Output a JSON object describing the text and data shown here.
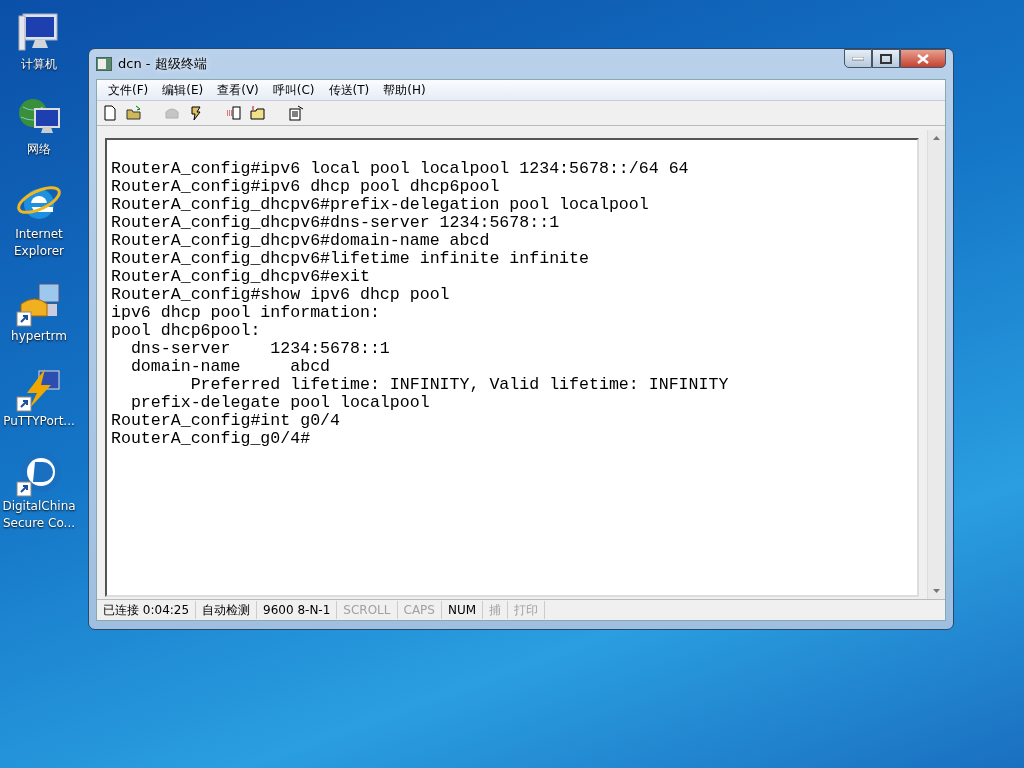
{
  "desktop_icons": [
    {
      "kind": "computer",
      "label": "计算机"
    },
    {
      "kind": "network",
      "label": "网络"
    },
    {
      "kind": "browser",
      "label": "Internet Explorer"
    },
    {
      "kind": "phone",
      "label": "hypertrm",
      "shortcut": true
    },
    {
      "kind": "bolt",
      "label": "PuTTYPort...",
      "shortcut": true
    },
    {
      "kind": "disc",
      "label": "DigitalChina Secure Co...",
      "shortcut": true
    }
  ],
  "window": {
    "title": "dcn - 超级终端",
    "menu": [
      "文件(F)",
      "编辑(E)",
      "查看(V)",
      "呼叫(C)",
      "传送(T)",
      "帮助(H)"
    ],
    "toolbar": [
      {
        "kind": "new",
        "disabled": false
      },
      {
        "kind": "open",
        "disabled": false
      },
      {
        "kind": "phone",
        "disabled": true
      },
      {
        "kind": "hangup",
        "disabled": false
      },
      {
        "kind": "send",
        "disabled": false
      },
      {
        "kind": "receive",
        "disabled": false
      },
      {
        "kind": "properties",
        "disabled": false
      }
    ],
    "terminal_lines": [
      "RouterA_config#ipv6 local pool localpool 1234:5678::/64 64",
      "RouterA_config#ipv6 dhcp pool dhcp6pool",
      "RouterA_config_dhcpv6#prefix-delegation pool localpool",
      "RouterA_config_dhcpv6#dns-server 1234:5678::1",
      "RouterA_config_dhcpv6#domain-name abcd",
      "RouterA_config_dhcpv6#lifetime infinite infinite",
      "RouterA_config_dhcpv6#exit",
      "RouterA_config#show ipv6 dhcp pool",
      "ipv6 dhcp pool information:",
      "pool dhcp6pool:",
      "  dns-server    1234:5678::1",
      "  domain-name     abcd",
      "        Preferred lifetime: INFINITY, Valid lifetime: INFINITY",
      "  prefix-delegate pool localpool",
      "RouterA_config#int g0/4",
      "RouterA_config_g0/4#"
    ],
    "status_bar": [
      {
        "text": "已连接 0:04:25",
        "active": true
      },
      {
        "text": "自动检测",
        "active": true
      },
      {
        "text": "9600 8-N-1",
        "active": true
      },
      {
        "text": "SCROLL",
        "active": false
      },
      {
        "text": "CAPS",
        "active": false
      },
      {
        "text": "NUM",
        "active": true
      },
      {
        "text": "捕",
        "active": false
      },
      {
        "text": "打印",
        "active": false
      }
    ]
  }
}
